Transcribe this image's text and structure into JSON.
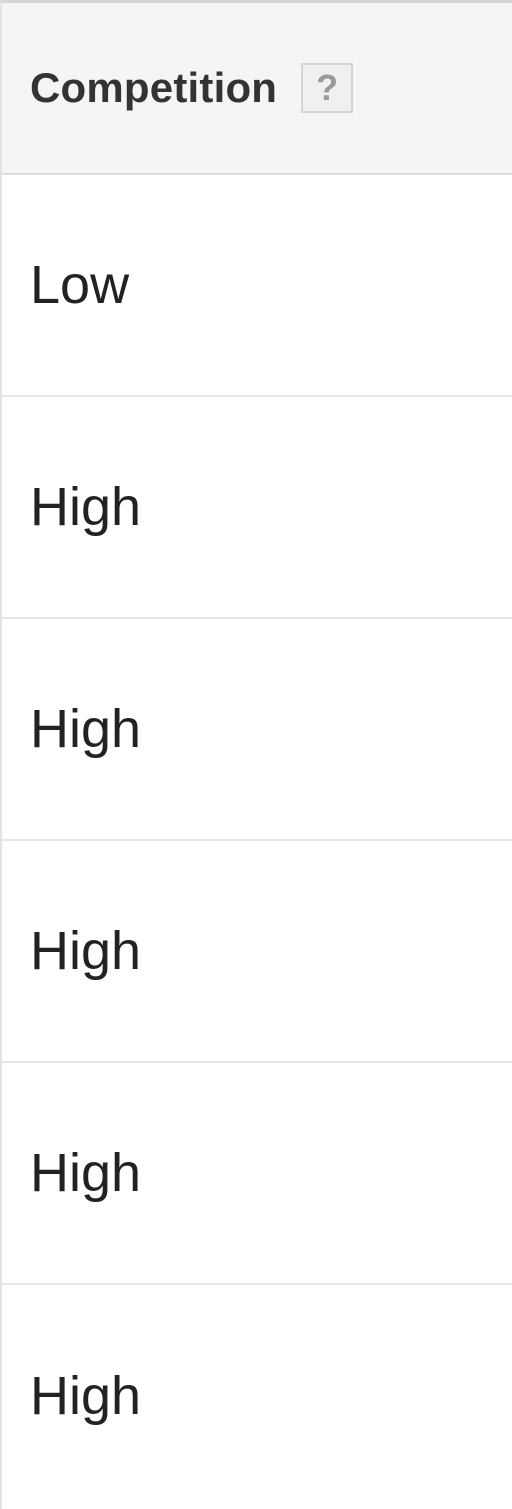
{
  "table": {
    "column_header": {
      "label": "Competition",
      "help_icon": "?",
      "help_icon_name": "help-question-icon"
    },
    "rows": [
      {
        "competition": "Low"
      },
      {
        "competition": "High"
      },
      {
        "competition": "High"
      },
      {
        "competition": "High"
      },
      {
        "competition": "High"
      },
      {
        "competition": "High"
      }
    ]
  },
  "colors": {
    "header_bg": "#f5f5f5",
    "border": "#e6e6e6",
    "text": "#222222"
  }
}
